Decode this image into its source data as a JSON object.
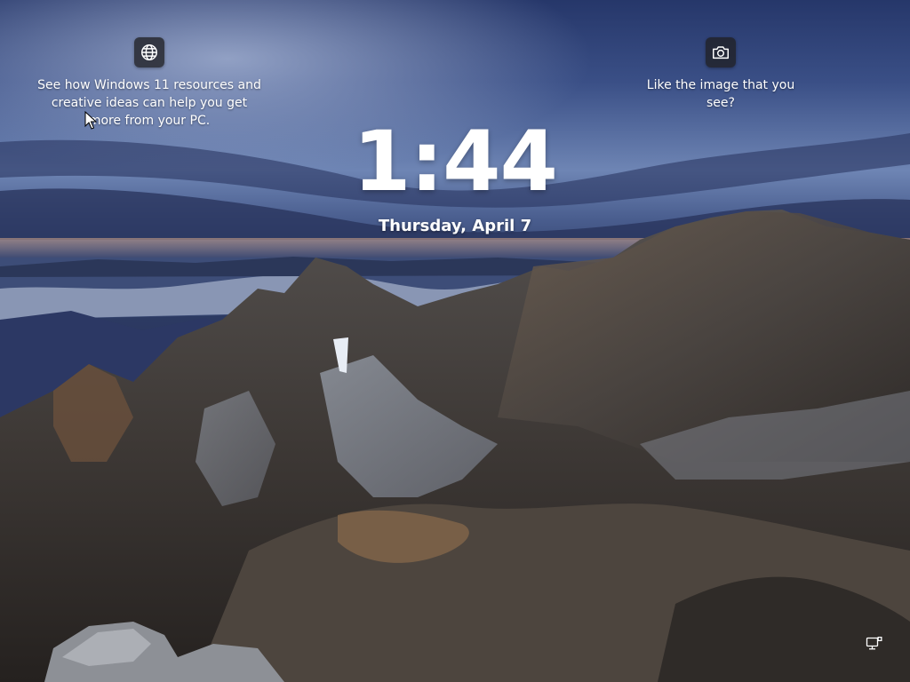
{
  "spotlight": {
    "learn_more_text": "See how Windows 11 resources and creative ideas can help you get more from your PC.",
    "like_image_text": "Like the image that you see?"
  },
  "clock": {
    "time": "1:44",
    "date": "Thursday, April 7"
  },
  "icons": {
    "learn_more": "globe-icon",
    "like_image": "camera-icon",
    "network": "network-ethernet-icon",
    "pointer": "mouse-cursor-icon"
  },
  "colors": {
    "text": "#ffffff",
    "icon_tile": "#202024"
  }
}
